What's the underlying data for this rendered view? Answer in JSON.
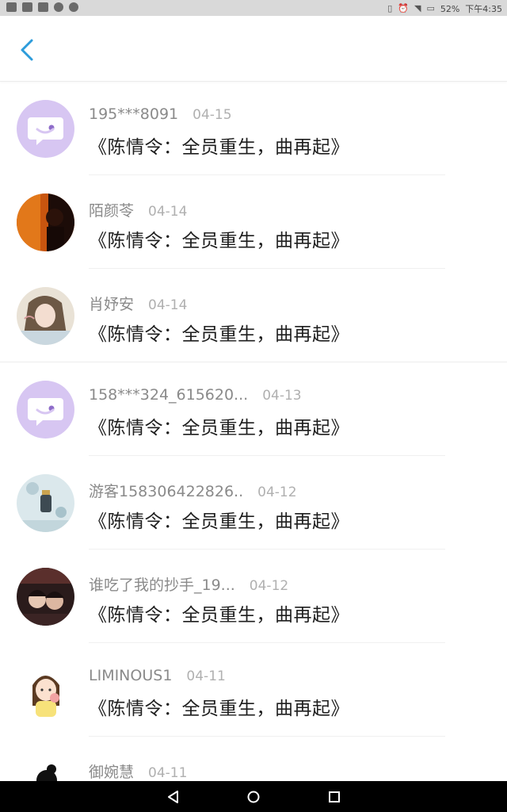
{
  "status_bar": {
    "battery": "52%",
    "time": "下午4:35"
  },
  "header": {
    "back_icon": "chevron-left-icon",
    "accent_color": "#2d9cdb"
  },
  "items": [
    {
      "username": "195***8091",
      "date": "04-15",
      "message": "《陈情令：全员重生，曲再起》",
      "avatar": "default-chat-avatar"
    },
    {
      "username": "陌颜苓",
      "date": "04-14",
      "message": "《陈情令：全员重生，曲再起》",
      "avatar": "photo-avatar"
    },
    {
      "username": "肖妤安",
      "date": "04-14",
      "message": "《陈情令：全员重生，曲再起》",
      "avatar": "anime-avatar"
    },
    {
      "username": "158***324_615620...",
      "date": "04-13",
      "message": "《陈情令：全员重生，曲再起》",
      "avatar": "default-chat-avatar"
    },
    {
      "username": "游客158306422826..",
      "date": "04-12",
      "message": "《陈情令：全员重生，曲再起》",
      "avatar": "illustration-avatar"
    },
    {
      "username": "谁吃了我的抄手_19...",
      "date": "04-12",
      "message": "《陈情令：全员重生，曲再起》",
      "avatar": "photo-avatar"
    },
    {
      "username": "LIMINOUS1",
      "date": "04-11",
      "message": "《陈情令：全员重生，曲再起》",
      "avatar": "cartoon-girl-avatar"
    },
    {
      "username": "御婉慧",
      "date": "04-11",
      "message": "",
      "avatar": "silhouette-avatar"
    }
  ],
  "nav_bar": {
    "back": "nav-back-icon",
    "home": "nav-home-icon",
    "recents": "nav-recents-icon"
  }
}
